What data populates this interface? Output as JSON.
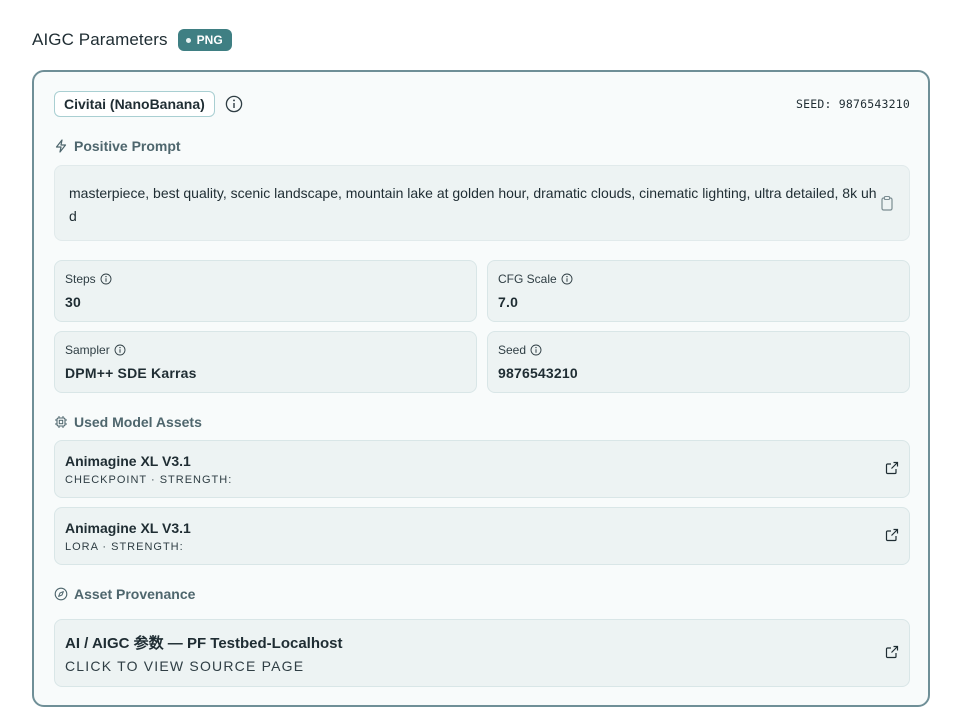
{
  "header": {
    "title": "AIGC Parameters",
    "badge": "PNG"
  },
  "source": {
    "label": "Civitai (NanoBanana)",
    "seed_label": "SEED: 9876543210"
  },
  "prompt": {
    "heading": "Positive Prompt",
    "text": "masterpiece, best quality, scenic landscape, mountain lake at golden hour, dramatic clouds, cinematic lighting, ultra detailed, 8k uhd"
  },
  "params": [
    {
      "label": "Steps",
      "value": "30"
    },
    {
      "label": "CFG Scale",
      "value": "7.0"
    },
    {
      "label": "Sampler",
      "value": "DPM++ SDE Karras"
    },
    {
      "label": "Seed",
      "value": "9876543210"
    }
  ],
  "assets": {
    "heading": "Used Model Assets",
    "items": [
      {
        "name": "Animagine XL V3.1",
        "meta": "CHECKPOINT · STRENGTH:"
      },
      {
        "name": "Animagine XL V3.1",
        "meta": "LORA · STRENGTH:"
      }
    ]
  },
  "provenance": {
    "heading": "Asset Provenance",
    "title": "AI / AIGC 参数 — PF Testbed-Localhost",
    "subtitle": "CLICK TO VIEW SOURCE PAGE"
  },
  "icons": {
    "info": "info-icon",
    "copy": "clipboard-icon",
    "prompt": "lightning-icon",
    "assets": "chip-icon",
    "provenance": "compass-icon",
    "external": "external-link-icon"
  },
  "colors": {
    "accent": "#3f7f83",
    "panel_border": "#6f8f97",
    "card_bg": "#edf3f3",
    "section_text": "#4e666d"
  }
}
